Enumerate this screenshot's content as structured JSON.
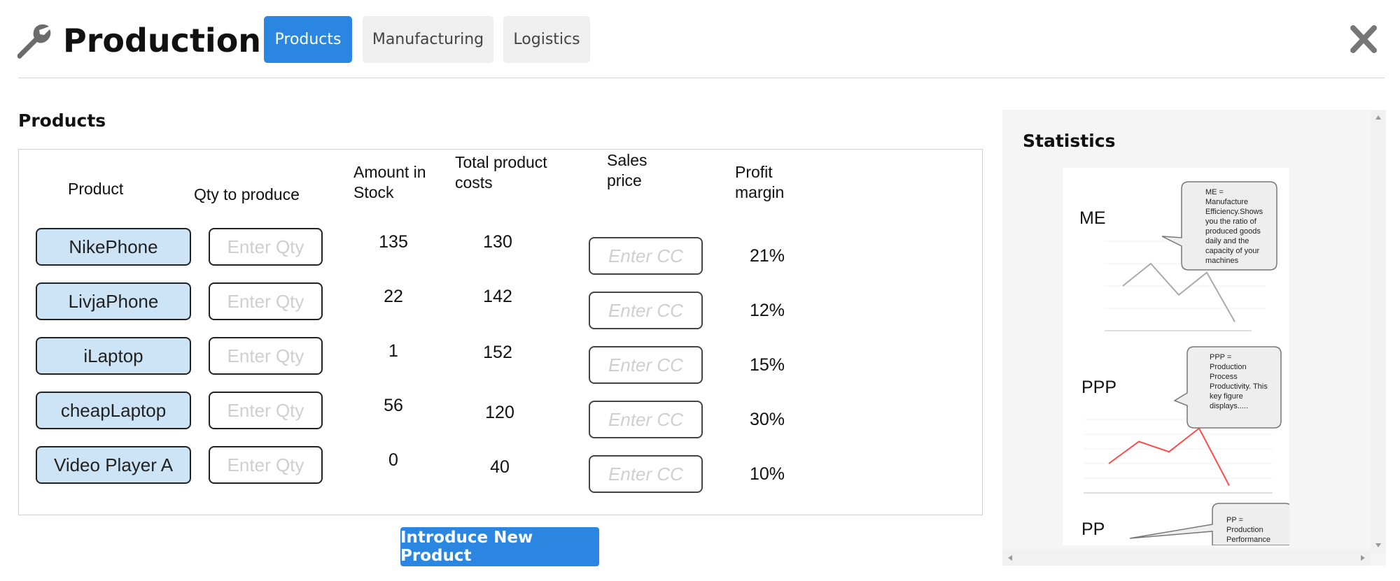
{
  "header": {
    "title": "Production",
    "tabs": [
      {
        "label": "Products",
        "active": true
      },
      {
        "label": "Manufacturing",
        "active": false
      },
      {
        "label": "Logistics",
        "active": false
      }
    ]
  },
  "products": {
    "heading": "Products",
    "columns": {
      "product": "Product",
      "qty": "Qty to produce",
      "stock": "Amount in\nStock",
      "total_costs": "Total product\ncosts",
      "sales_price": "Sales\nprice",
      "profit_margin": "Profit\nmargin"
    },
    "qty_placeholder": "Enter Qty",
    "price_placeholder": "Enter CC",
    "rows": [
      {
        "name": "NikePhone",
        "stock": "135",
        "costs": "130",
        "margin": "21%"
      },
      {
        "name": "LivjaPhone",
        "stock": "22",
        "costs": "142",
        "margin": "12%"
      },
      {
        "name": "iLaptop",
        "stock": "1",
        "costs": "152",
        "margin": "15%"
      },
      {
        "name": "cheapLaptop",
        "stock": "56",
        "costs": "120",
        "margin": "30%"
      },
      {
        "name": "Video Player A",
        "stock": "0",
        "costs": "40",
        "margin": "10%"
      }
    ],
    "introduce_label": "Introduce New Product"
  },
  "statistics": {
    "heading": "Statistics",
    "kpis": [
      {
        "label": "ME",
        "bubble": "ME =\nManufacture\nEfficiency.Shows\nyou the ratio of\nproduced goods\ndaily and the\ncapacity of your\nmachines",
        "color": "#aaaaaa",
        "values": [
          0.5,
          0.75,
          0.4,
          0.65,
          0.1
        ],
        "ticks": [
          "1",
          "0.75",
          "0.5",
          "0.25",
          "0"
        ]
      },
      {
        "label": "PPP",
        "bubble": "PPP =\nProduction\nProcess\nProductivity. This\nkey figure\ndisplays.....",
        "color": "#ff4a4a",
        "values": [
          2,
          3.5,
          2.8,
          4.4,
          0.5
        ],
        "ticks": [
          "5",
          "4",
          "3",
          "2",
          "1",
          "0"
        ]
      },
      {
        "label": "PP",
        "bubble": "PP =\nProduction\nPerformance",
        "color": "#888888"
      }
    ]
  },
  "colors": {
    "accent": "#2a86e0",
    "product_button": "#cde4f6",
    "tab_inactive": "#efefef"
  }
}
